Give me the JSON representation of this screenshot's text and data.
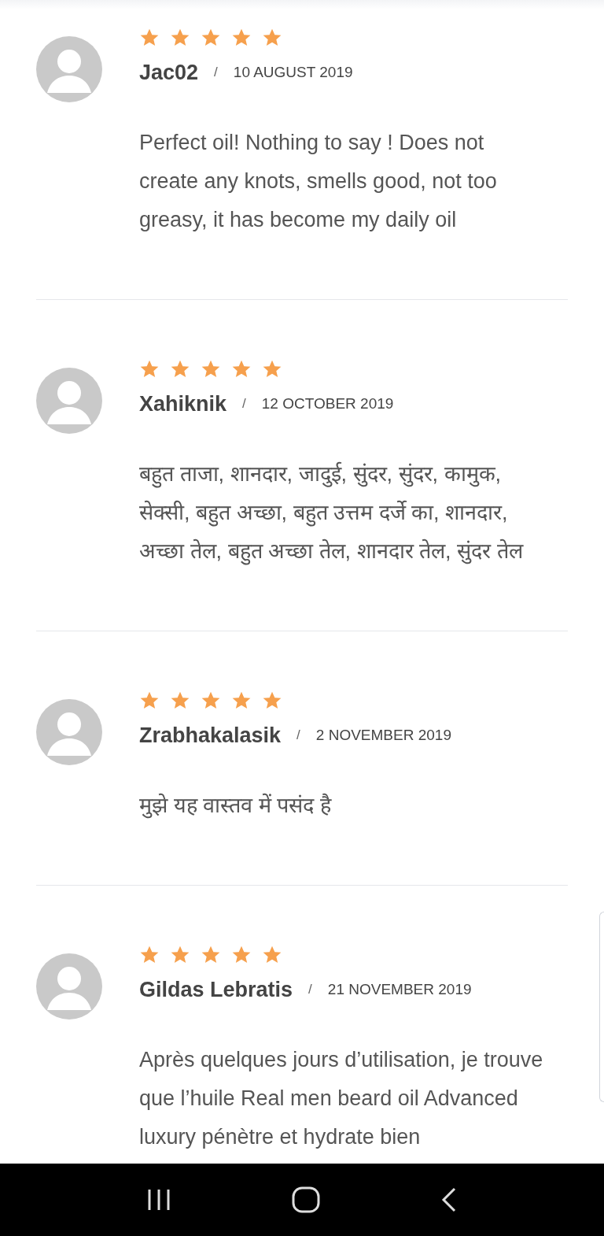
{
  "reviews": [
    {
      "stars": 5,
      "author": "Jac02",
      "separator": "/",
      "date": "10 AUGUST 2019",
      "text": "Perfect oil! Nothing to say ! Does not create any knots, smells good, not too greasy, it has become my daily oil"
    },
    {
      "stars": 5,
      "author": "Xahiknik",
      "separator": "/",
      "date": "12 OCTOBER 2019",
      "text": "बहुत ताजा, शानदार, जादुई, सुंदर, सुंदर, कामुक, सेक्सी, बहुत अच्छा, बहुत उत्तम दर्जे का, शानदार, अच्छा तेल, बहुत अच्छा तेल, शानदार तेल, सुंदर तेल"
    },
    {
      "stars": 5,
      "author": "Zrabhakalasik",
      "separator": "/",
      "date": "2 NOVEMBER 2019",
      "text": "मुझे यह वास्तव में पसंद है"
    },
    {
      "stars": 5,
      "author": "Gildas Lebratis",
      "separator": "/",
      "date": "21 NOVEMBER 2019",
      "text": "Après quelques jours d’utilisation, je trouve que l’huile Real men beard oil Advanced luxury pénètre et hydrate bien"
    }
  ]
}
